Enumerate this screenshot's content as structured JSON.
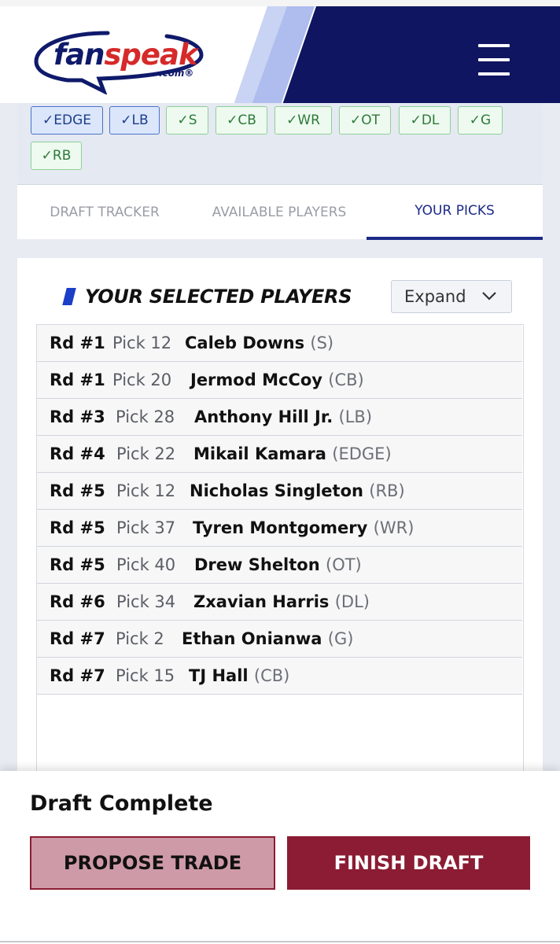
{
  "header": {
    "logo_fan": "fan",
    "logo_speak": "speak",
    "logo_com": ".com®",
    "menu_icon": "hamburger-menu-icon"
  },
  "filters": [
    {
      "label": "✓EDGE",
      "state": "selected"
    },
    {
      "label": "✓LB",
      "state": "selected"
    },
    {
      "label": "✓S",
      "state": "done"
    },
    {
      "label": "✓CB",
      "state": "done"
    },
    {
      "label": "✓WR",
      "state": "done"
    },
    {
      "label": "✓OT",
      "state": "done"
    },
    {
      "label": "✓DL",
      "state": "done"
    },
    {
      "label": "✓G",
      "state": "done"
    },
    {
      "label": "✓RB",
      "state": "done"
    }
  ],
  "tabs": [
    {
      "label": "DRAFT TRACKER",
      "active": false
    },
    {
      "label": "AVAILABLE PLAYERS",
      "active": false
    },
    {
      "label": "YOUR PICKS",
      "active": true
    }
  ],
  "section": {
    "title": "YOUR SELECTED PLAYERS",
    "expand_label": "Expand"
  },
  "picks": [
    {
      "round": "Rd #1",
      "pick": "Pick 12",
      "name": "Caleb Downs",
      "pos": "(S)"
    },
    {
      "round": "Rd #1",
      "pick": "Pick 20",
      "name": "Jermod McCoy",
      "pos": "(CB)"
    },
    {
      "round": "Rd #3",
      "pick": "Pick 28",
      "name": "Anthony Hill Jr.",
      "pos": "(LB)"
    },
    {
      "round": "Rd #4",
      "pick": "Pick 22",
      "name": "Mikail Kamara",
      "pos": "(EDGE)"
    },
    {
      "round": "Rd #5",
      "pick": "Pick 12",
      "name": "Nicholas Singleton",
      "pos": "(RB)"
    },
    {
      "round": "Rd #5",
      "pick": "Pick 37",
      "name": "Tyren Montgomery",
      "pos": "(WR)"
    },
    {
      "round": "Rd #5",
      "pick": "Pick 40",
      "name": "Drew Shelton",
      "pos": "(OT)"
    },
    {
      "round": "Rd #6",
      "pick": "Pick 34",
      "name": "Zxavian Harris",
      "pos": "(DL)"
    },
    {
      "round": "Rd #7",
      "pick": "Pick 2",
      "name": "Ethan Onianwa",
      "pos": "(G)"
    },
    {
      "round": "Rd #7",
      "pick": "Pick 15",
      "name": "TJ Hall",
      "pos": "(CB)"
    }
  ],
  "footer": {
    "status": "Draft Complete",
    "propose_trade": "PROPOSE TRADE",
    "finish_draft": "FINISH DRAFT"
  },
  "colors": {
    "header_dark": "#0f1560",
    "accent_blue": "#1b2a88",
    "maroon": "#8b1c33",
    "maroon_light": "#cf9aa8",
    "chip_selected_border": "#4b72c8",
    "chip_done_border": "#8fcf98"
  }
}
